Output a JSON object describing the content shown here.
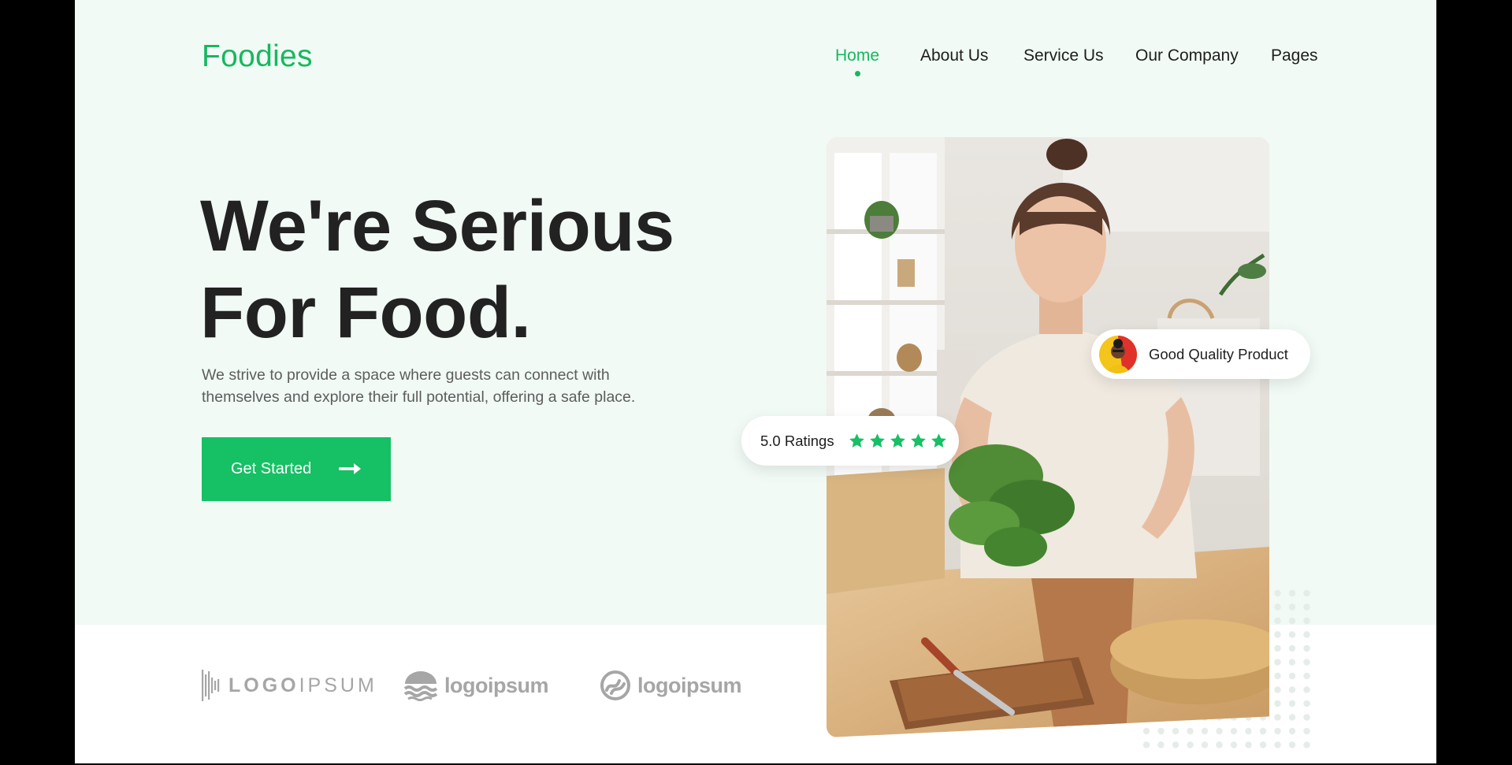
{
  "brand": {
    "name": "Foodies",
    "accent_color": "#16b85f"
  },
  "nav": {
    "items": [
      {
        "label": "Home",
        "active": true
      },
      {
        "label": "About Us",
        "active": false
      },
      {
        "label": "Service Us",
        "active": false
      },
      {
        "label": "Our Company",
        "active": false
      },
      {
        "label": "Pages",
        "active": false
      }
    ]
  },
  "hero": {
    "headline_line1": "We're Serious",
    "headline_line2": "For Food.",
    "subtext_line1": "We strive to provide a space where guests can connect with",
    "subtext_line2": "themselves and explore their full potential, offering a safe place.",
    "cta_label": "Get Started",
    "cta_icon": "arrow-right-icon",
    "background_color": "#f1faf5"
  },
  "badges": {
    "ratings_label": "5.0 Ratings",
    "star_count": 5,
    "quality_label": "Good Quality Product"
  },
  "partner_logos": [
    {
      "text_regular": "LOGO",
      "text_light": "IPSUM",
      "icon": "soundwave-icon"
    },
    {
      "text": "logoipsum",
      "icon": "waves-icon"
    },
    {
      "text": "logoipsum",
      "icon": "swirl-icon"
    }
  ]
}
